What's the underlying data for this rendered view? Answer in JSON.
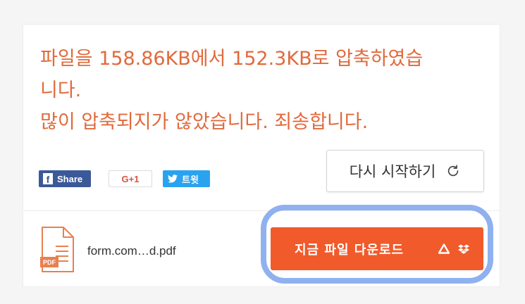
{
  "message": {
    "line1": "파일을 158.86KB에서 152.3KB로 압축하였습",
    "line2": "니다.",
    "line3": "많이 압축되지가 않았습니다. 죄송합니다."
  },
  "share": {
    "facebook_label": "Share",
    "google_label": "G+1",
    "twitter_label": "트윗"
  },
  "restart_label": "다시 시작하기",
  "file": {
    "name": "form.com…d.pdf",
    "icon_text": "PDF"
  },
  "download_label": "지금 파일 다운로드",
  "colors": {
    "message": "#e06a3c",
    "download": "#f15a2b",
    "facebook": "#3b5998",
    "twitter": "#2aa3ef",
    "highlight": "#8fb1ef"
  }
}
